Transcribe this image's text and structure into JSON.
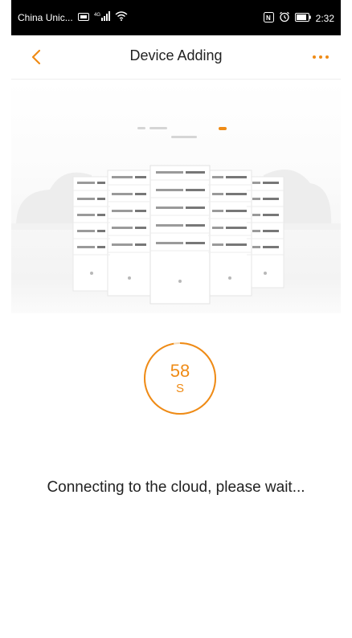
{
  "status_bar": {
    "carrier": "China Unic...",
    "network_label": "4G",
    "time": "2:32"
  },
  "nav": {
    "title": "Device Adding",
    "back_icon": "chevron-left-icon",
    "more_icon": "more-dots-icon"
  },
  "countdown": {
    "value": "58",
    "unit": "S",
    "progress_fraction": 0.97
  },
  "message": "Connecting to the cloud, please wait...",
  "colors": {
    "accent": "#ef8b16",
    "status_bar_bg": "#000000",
    "text": "#222222"
  }
}
